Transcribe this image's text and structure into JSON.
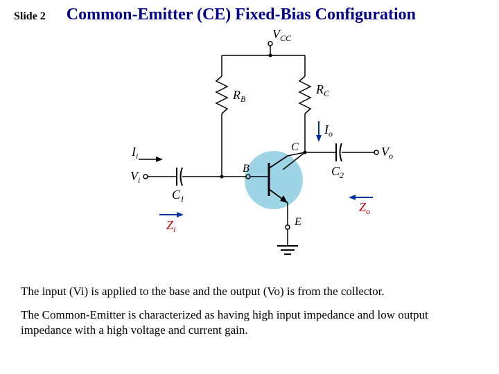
{
  "header": {
    "slide": "Slide 2",
    "title": "Common-Emitter (CE) Fixed-Bias Configuration"
  },
  "diagram": {
    "labels": {
      "vcc": "V",
      "vcc_sub": "CC",
      "rb": "R",
      "rb_sub": "B",
      "rc": "R",
      "rc_sub": "C",
      "c1": "C",
      "c1_sub": "1",
      "c2": "C",
      "c2_sub": "2",
      "vi": "V",
      "vi_sub": "i",
      "vo": "V",
      "vo_sub": "o",
      "ii": "I",
      "ii_sub": "i",
      "io": "I",
      "io_sub": "o",
      "zi": "Z",
      "zi_sub": "i",
      "zo": "Z",
      "zo_sub": "o",
      "b": "B",
      "c": "C",
      "e": "E"
    }
  },
  "text": {
    "p1": "The input (Vi) is applied to the base and the output (Vo) is from the collector.",
    "p2": "The Common-Emitter is characterized as having high input impedance and low output impedance with a high voltage and current gain."
  }
}
